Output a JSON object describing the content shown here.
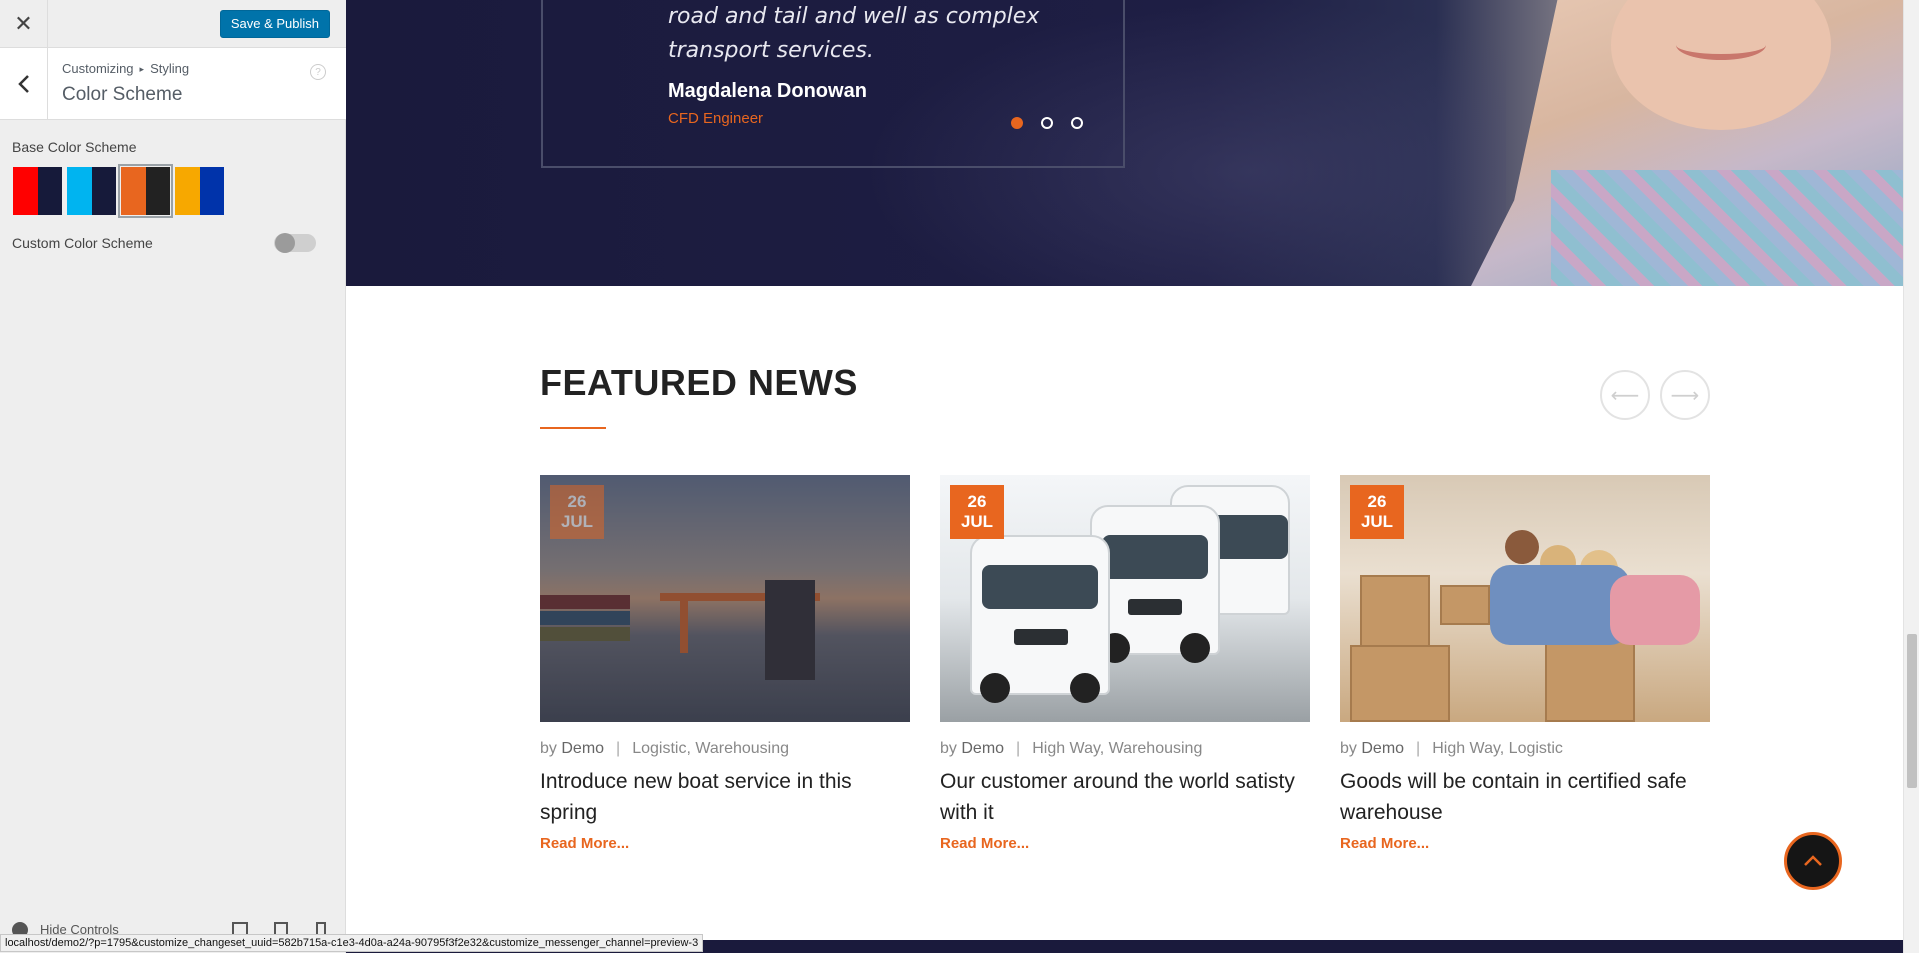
{
  "customizer": {
    "close_symbol": "✕",
    "save_label": "Save & Publish",
    "breadcrumb": {
      "root": "Customizing",
      "separator": "▸",
      "section": "Styling"
    },
    "section_title": "Color Scheme",
    "base_scheme_label": "Base Color Scheme",
    "swatches": [
      {
        "name": "red-navy",
        "colors": [
          "#ff0000",
          "#161a3a"
        ],
        "selected": false
      },
      {
        "name": "cyan-navy",
        "colors": [
          "#00b4f0",
          "#161a3a"
        ],
        "selected": false
      },
      {
        "name": "orange-charcoal",
        "colors": [
          "#e8661f",
          "#222222"
        ],
        "selected": true
      },
      {
        "name": "amber-blue",
        "colors": [
          "#f7a800",
          "#0033aa"
        ],
        "selected": false
      }
    ],
    "custom_scheme_label": "Custom Color Scheme",
    "custom_scheme_enabled": false,
    "hide_controls_label": "Hide Controls"
  },
  "status_url": "localhost/demo2/?p=1795&customize_changeset_uuid=582b715a-c1e3-4d0a-a24a-90795f3f2e32&customize_messenger_channel=preview-3",
  "testimonial": {
    "quote": "road and tail and well as complex transport services.",
    "name": "Magdalena Donowan",
    "role": "CFD Engineer",
    "active_dot": 1
  },
  "featured": {
    "title": "FEATURED NEWS",
    "prev_arrow": "⟵",
    "next_arrow": "⟶",
    "posts": [
      {
        "day": "26",
        "month": "JUL",
        "by": "by",
        "author": "Demo",
        "categories": "Logistic, Warehousing",
        "title": "Introduce new boat service in this spring",
        "read_more": "Read More..."
      },
      {
        "day": "26",
        "month": "JUL",
        "by": "by",
        "author": "Demo",
        "categories": "High Way, Warehousing",
        "title": "Our customer around the world satisty with it",
        "read_more": "Read More..."
      },
      {
        "day": "26",
        "month": "JUL",
        "by": "by",
        "author": "Demo",
        "categories": "High Way, Logistic",
        "title": "Goods will be contain in certified safe warehouse",
        "read_more": "Read More..."
      }
    ]
  },
  "colors": {
    "accent": "#e8661f",
    "wp_blue": "#0073aa",
    "hero_navy": "#1a1a3c"
  },
  "icons": [
    "close-icon",
    "back-arrow-icon",
    "help-icon",
    "chevron-up-icon",
    "arrow-left-icon",
    "arrow-right-icon",
    "eye-icon",
    "desktop-icon",
    "tablet-icon",
    "mobile-icon"
  ]
}
